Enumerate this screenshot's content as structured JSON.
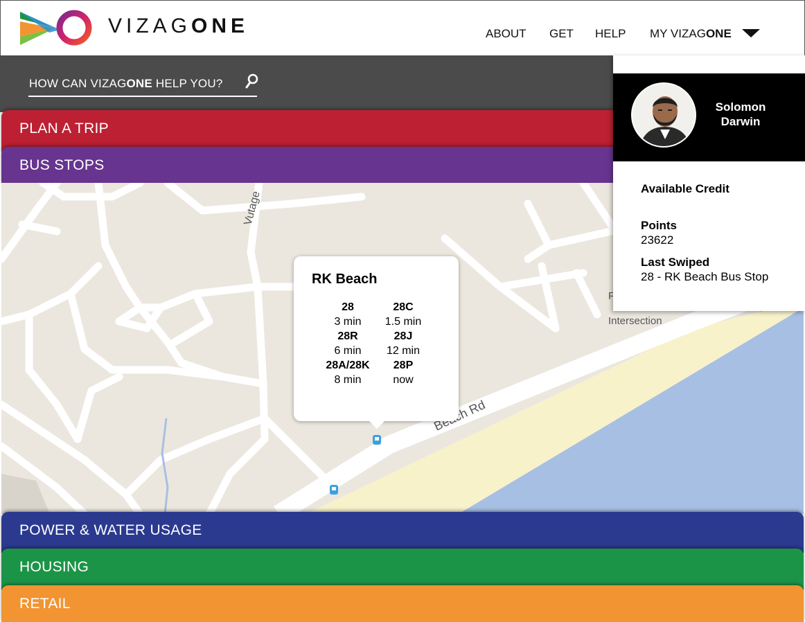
{
  "header": {
    "brand_light": "VIZAG",
    "brand_bold": "ONE",
    "nav": {
      "about": "ABOUT",
      "get": "GET",
      "help": "HELP",
      "my_prefix": "MY VIZAG",
      "my_bold": "ONE"
    }
  },
  "search": {
    "prefix": "HOW CAN VIZAG",
    "bold": "ONE",
    "suffix": " HELP YOU?"
  },
  "sections": {
    "plan_trip": "PLAN A TRIP",
    "bus_stops": "BUS STOPS",
    "power_water": "POWER & WATER USAGE",
    "housing": "HOUSING",
    "retail": "RETAIL"
  },
  "map": {
    "road_vutagedda": "Vutage",
    "road_beach": "Beach Rd",
    "place_intersection": "Intersection",
    "place_partial": "F"
  },
  "popup": {
    "title": "RK Beach",
    "routes": [
      {
        "number": "28",
        "eta": "3 min"
      },
      {
        "number": "28C",
        "eta": "1.5 min"
      },
      {
        "number": "28R",
        "eta": "6 min"
      },
      {
        "number": "28J",
        "eta": "12 min"
      },
      {
        "number": "28A/28K",
        "eta": "8 min"
      },
      {
        "number": "28P",
        "eta": "now"
      }
    ]
  },
  "profile": {
    "first_name": "Solomon",
    "last_name": "Darwin",
    "available_credit_label": "Available Credit",
    "points_label": "Points",
    "points_value": "23622",
    "last_swiped_label": "Last Swiped",
    "last_swiped_value": "28 - RK Beach Bus Stop"
  },
  "colors": {
    "plan_trip": "#bc2032",
    "bus_stops": "#67348f",
    "power_water": "#2b3a8f",
    "housing": "#1c9447",
    "retail": "#f29432",
    "search_bg": "#4b4b4b",
    "sea": "#a7bfe3",
    "sand": "#f8f2cb",
    "land": "#ebe7df"
  },
  "icons": {
    "logo": "vizagone-logo-icon",
    "search": "search-icon",
    "caret": "caret-down-icon",
    "bus_stop": "bus-stop-icon",
    "avatar": "avatar"
  }
}
